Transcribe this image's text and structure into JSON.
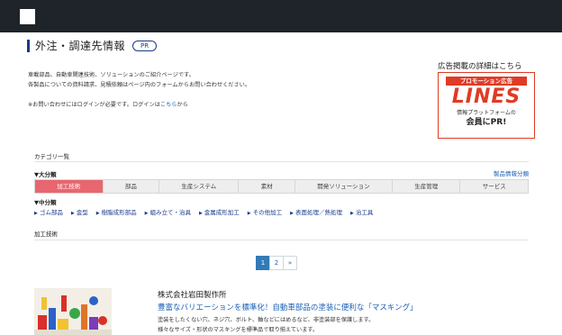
{
  "header": {
    "title": "外注・調達先情報",
    "badge": "PR"
  },
  "intro": {
    "line1": "車載部品、自動車関連技術、ソリューションのご紹介ページです。",
    "line2": "各製品についての資料請求、見積依頼はページ内のフォームからお問い合わせください。",
    "login_note_prefix": "※お問い合わせにはログインが必要です。ログインは",
    "login_link": "こちら",
    "login_note_suffix": "から"
  },
  "ad": {
    "caption": "広告掲載の詳細はこちら",
    "promo_label": "プロモーション広告",
    "brand": "LINES",
    "sub": "情報プラットフォームの",
    "cta": "会員にPR!"
  },
  "category": {
    "heading": "カテゴリ一覧",
    "major_label": "▼大分類",
    "product_link": "製品情報分類",
    "tabs": [
      "加工技術",
      "部品",
      "生産システム",
      "素材",
      "開発ソリューション",
      "生産管理",
      "サービス"
    ],
    "active_tab": 0,
    "minor_label": "▼中分類",
    "sublinks": [
      "ゴム部品",
      "金型",
      "樹脂成形部品",
      "組み立て・治具",
      "金属成形加工",
      "その他加工",
      "表面処理／熱処理",
      "治工具"
    ],
    "tech_label": "加工技術"
  },
  "pagination": {
    "pages": [
      "1",
      "2",
      "»"
    ],
    "active": 0
  },
  "listing": {
    "company": "株式会社岩田製作所",
    "title": "豊富なバリエーションを標準化！自動車部品の塗装に便利な「マスキング」",
    "desc1": "塗装をしたくない穴、ネジ穴、ボルト、軸などにはめるなど、非塗装部を保護します。",
    "desc2": "様々なサイズ・形状のマスキングを標準品で取り揃えています。"
  },
  "colors": {
    "topbar": "#1f242b",
    "accent_red": "#e03b24",
    "active_tab": "#e8666f",
    "link": "#1a5fb4"
  }
}
